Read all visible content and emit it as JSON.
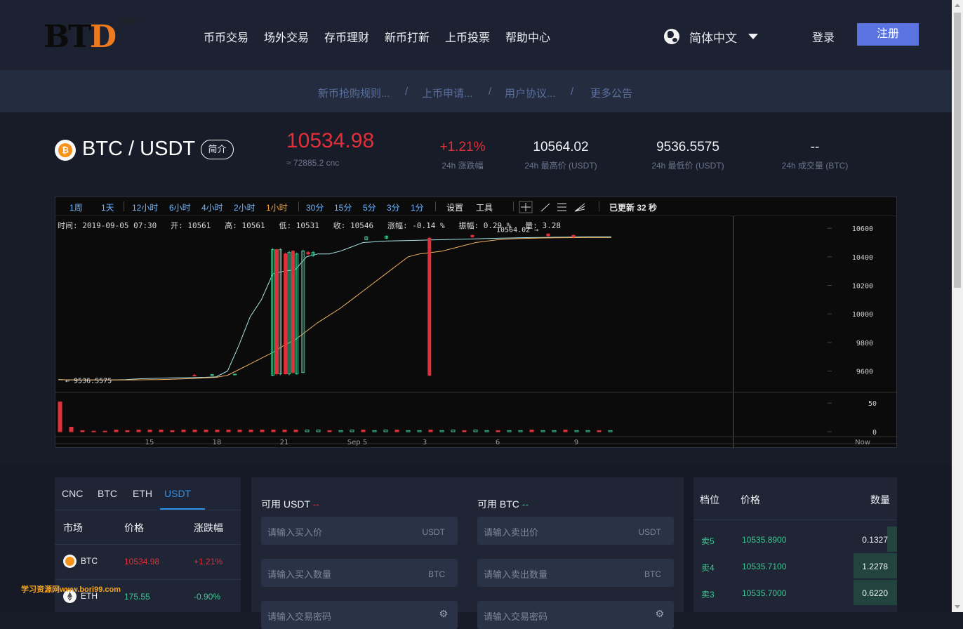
{
  "header": {
    "logo_text": "BTD",
    "logo_sup": "PRO",
    "nav": [
      "币币交易",
      "场外交易",
      "存币理财",
      "新币打新",
      "上币投票",
      "帮助中心"
    ],
    "language": "简体中文",
    "login": "登录",
    "register": "注册"
  },
  "announcements": [
    "新币抢购规则...",
    "/",
    "上币申请...",
    "/",
    "用户协议...",
    "/",
    "更多公告"
  ],
  "ticker": {
    "pair": "BTC / USDT",
    "intro_label": "简介",
    "price": "10534.98",
    "price_cny": "≈ 72885.2 cnc",
    "change": "+1.21%",
    "change_label": "24h 涨跌幅",
    "high": "10564.02",
    "high_label": "24h 最高价 (USDT)",
    "low": "9536.5575",
    "low_label": "24h 最低价 (USDT)",
    "volume": "--",
    "volume_label": "24h 成交量 (BTC)"
  },
  "chart_toolbar": {
    "intervals": [
      "1周",
      "1天",
      "12小时",
      "6小时",
      "4小时",
      "2小时",
      "1小时",
      "30分",
      "15分",
      "5分",
      "3分",
      "1分"
    ],
    "active_interval": "1小时",
    "settings": "设置",
    "tools": "工具",
    "updated": "已更新 32 秒"
  },
  "chart_info": "时间: 2019-09-05 07:30   开: 10561   高: 10561   低: 10531   收: 10546   涨幅: -0.14 %   振幅: 0.29 %   量: 3.28",
  "chart_data": {
    "type": "line",
    "x_ticks": [
      "15",
      "18",
      "21",
      "Sep 5",
      "3",
      "6",
      "9",
      "Now"
    ],
    "price_ticks": [
      10600,
      10400,
      10200,
      10000,
      9800,
      9600
    ],
    "ylim": [
      9460,
      10640
    ],
    "volume_ticks": [
      50,
      0
    ],
    "last_price_label": "10564.02",
    "low_marker_label": "9536.5575",
    "series": [
      {
        "values": [
          9540,
          9538,
          9537,
          9537,
          9537,
          9538,
          9540,
          9545,
          9548,
          9550,
          9552,
          9553,
          9554,
          9556,
          9560,
          9600,
          9780,
          9980,
          10100,
          10280,
          10300,
          10310,
          10400,
          10420,
          10420,
          10440,
          10470,
          10500,
          10505,
          10510,
          10512,
          10514,
          10516,
          10518,
          10520,
          10522,
          10524,
          10526,
          10528,
          10530,
          10532,
          10534,
          10535,
          10536,
          10537,
          10538,
          10539,
          10540,
          10540,
          10540
        ]
      },
      {
        "values": [
          9540,
          9538,
          9537,
          9537,
          9537,
          9537,
          9537,
          9538,
          9539,
          9540,
          9542,
          9545,
          9548,
          9552,
          9556,
          9570,
          9610,
          9650,
          9690,
          9730,
          9780,
          9820,
          9880,
          9940,
          9990,
          10040,
          10100,
          10160,
          10220,
          10280,
          10340,
          10400,
          10420,
          10430,
          10440,
          10460,
          10480,
          10500,
          10510,
          10520,
          10525,
          10528,
          10530,
          10532,
          10533,
          10534,
          10535,
          10535,
          10535,
          10535
        ]
      }
    ],
    "candles": [
      {
        "t": 16.5,
        "o": 9570,
        "c": 9568,
        "h": 9580,
        "l": 9565
      },
      {
        "t": 17.2,
        "o": 9570,
        "c": 9575,
        "h": 9578,
        "l": 9566
      },
      {
        "t": 18.1,
        "o": 9575,
        "c": 9578,
        "h": 9580,
        "l": 9572
      },
      {
        "t": 19.6,
        "o": 9570,
        "c": 10450,
        "h": 10460,
        "l": 9565
      },
      {
        "t": 19.75,
        "o": 10450,
        "c": 9580,
        "h": 10455,
        "l": 9570
      },
      {
        "t": 19.9,
        "o": 9580,
        "c": 10450,
        "h": 10460,
        "l": 9570
      },
      {
        "t": 20.1,
        "o": 10420,
        "c": 9580,
        "h": 10430,
        "l": 9575
      },
      {
        "t": 20.25,
        "o": 9580,
        "c": 10430,
        "h": 10440,
        "l": 9570
      },
      {
        "t": 20.4,
        "o": 10440,
        "c": 9590,
        "h": 10445,
        "l": 9580
      },
      {
        "t": 20.55,
        "o": 9580,
        "c": 10420,
        "h": 10430,
        "l": 9575
      },
      {
        "t": 20.8,
        "o": 9590,
        "c": 10440,
        "h": 10450,
        "l": 9585
      },
      {
        "t": 21.0,
        "o": 10430,
        "c": 10420,
        "h": 10440,
        "l": 10410
      },
      {
        "t": 21.2,
        "o": 10410,
        "c": 10430,
        "h": 10440,
        "l": 10400
      },
      {
        "t": 23.3,
        "o": 10520,
        "c": 10540,
        "h": 10545,
        "l": 10515
      },
      {
        "t": 24.1,
        "o": 10530,
        "c": 10545,
        "h": 10550,
        "l": 10525
      },
      {
        "t": 25.8,
        "o": 10530,
        "c": 9570,
        "h": 10540,
        "l": 9565
      },
      {
        "t": 27.5,
        "o": 10550,
        "c": 10540,
        "h": 10555,
        "l": 10535
      },
      {
        "t": 30.5,
        "o": 10560,
        "c": 10548,
        "h": 10564,
        "l": 10540
      },
      {
        "t": 31.5,
        "o": 10550,
        "c": 10540,
        "h": 10555,
        "l": 10530
      }
    ],
    "volumes": [
      52,
      8,
      2,
      1,
      1,
      3,
      2,
      3,
      3,
      3,
      2,
      3,
      3,
      3,
      3,
      3,
      3,
      3,
      3,
      3,
      3,
      3,
      3,
      3,
      2,
      2,
      3,
      3,
      2,
      3,
      3,
      2,
      2,
      3,
      2,
      3,
      2,
      3,
      2,
      2,
      2,
      2,
      3,
      2,
      2,
      3,
      2,
      2,
      2,
      2
    ]
  },
  "markets": {
    "tabs": [
      "CNC",
      "BTC",
      "ETH",
      "USDT"
    ],
    "active_tab": "USDT",
    "headers": [
      "市场",
      "价格",
      "涨跌幅"
    ],
    "rows": [
      {
        "symbol": "BTC",
        "price": "10534.98",
        "change": "+1.21%",
        "up": false
      },
      {
        "symbol": "ETH",
        "price": "175.55",
        "change": "-0.90%",
        "up": true
      }
    ]
  },
  "trade": {
    "buy_available_label": "可用 USDT",
    "buy_available_value": "--",
    "sell_available_label": "可用 BTC",
    "sell_available_value": "--",
    "buy_price_placeholder": "请输入买入价",
    "buy_price_unit": "USDT",
    "buy_amount_placeholder": "请输入买入数量",
    "buy_amount_unit": "BTC",
    "buy_password_placeholder": "请输入交易密码",
    "sell_price_placeholder": "请输入卖出价",
    "sell_price_unit": "USDT",
    "sell_amount_placeholder": "请输入卖出数量",
    "sell_amount_unit": "BTC",
    "sell_password_placeholder": "请输入交易密码"
  },
  "orderbook": {
    "headers": [
      "档位",
      "价格",
      "数量"
    ],
    "rows": [
      {
        "level": "卖5",
        "price": "10535.8900",
        "qty": "0.1327",
        "depth": 0.22
      },
      {
        "level": "卖4",
        "price": "10535.7100",
        "qty": "1.2278",
        "depth": 1.0
      },
      {
        "level": "卖3",
        "price": "10535.7000",
        "qty": "0.6220",
        "depth": 1.0
      }
    ]
  },
  "watermark": "学习资源网www.bori99.com",
  "colors": {
    "up": "#3fc591",
    "down": "#e0303a",
    "accent": "#5b73e0",
    "bg": "#181c28"
  }
}
